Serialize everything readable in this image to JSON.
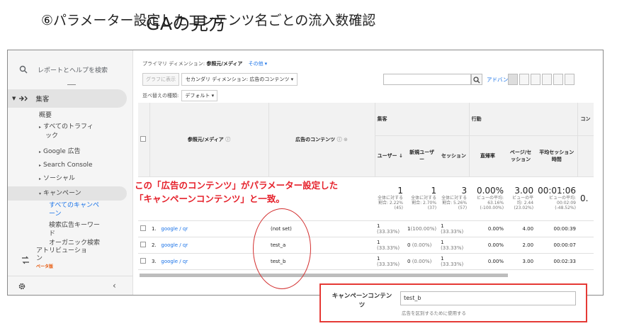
{
  "slide": {
    "title": "GAの見方",
    "subtitle": "⑥パラメーター設定したコンテンツ名ごとの流入数確認"
  },
  "sidebar": {
    "search_placeholder": "レポートとヘルプを検索",
    "acquisition": "集客",
    "items": {
      "overview": "概要",
      "all_traffic_1": "すべてのトラフィ",
      "all_traffic_2": "ック",
      "google_ads": "Google 広告",
      "search_console": "Search Console",
      "social": "ソーシャル",
      "campaigns": "キャンペーン",
      "all_campaigns_1": "すべてのキャンペ",
      "all_campaigns_2": "ーン",
      "paid_keywords_1": "検索広告キーワー",
      "paid_keywords_2": "ド",
      "organic_keywords": "オーガニック検索"
    },
    "attribution_1": "アトリビューショ",
    "attribution_2": "ン",
    "beta": "ベータ版"
  },
  "report": {
    "primary_dim_label": "プライマリ ディメンション:",
    "primary_dim_value": "参照元/メディア",
    "other_label": "その他",
    "graph_btn": "グラフに表示",
    "secondary_dim_btn": "セカンダリ ディメンション: 広告のコンテンツ",
    "sort_label": "並べ替えの種類:",
    "sort_value": "デフォルト",
    "advanced": "アドバンス",
    "group_acq": "集客",
    "group_beh": "行動",
    "group_conv": "コン",
    "col_source": "参照元/メディア",
    "col_content": "広告のコンテンツ",
    "col_users": "ユーザー",
    "col_new_users": "新規ユーザー",
    "col_sessions": "セッション",
    "col_bounce": "直帰率",
    "col_pages": "ページ/セッション",
    "col_duration": "平均セッション時間",
    "totals": {
      "users": "1",
      "users_sub": "全体に対する割合: 2.22% (45)",
      "new_users": "1",
      "new_users_sub": "全体に対する割合: 2.70% (37)",
      "sessions": "3",
      "sessions_sub": "全体に対する割合: 5.26% (57)",
      "bounce": "0.00%",
      "bounce_sub": "ビューの平均: 63.16% (-100.00%)",
      "pages": "3.00",
      "pages_sub": "ビューの平均: 2.44 (23.02%)",
      "duration": "00:01:06",
      "duration_sub": "ビューの平均: 00:02:09 (-48.52%)",
      "conv": "0."
    },
    "rows": [
      {
        "idx": "1.",
        "source": "google / qr",
        "content": "(not set)",
        "users": "1",
        "users_pct": "(33.33%)",
        "new_users": "1",
        "new_users_pct": "(100.00%)",
        "sessions": "1",
        "sessions_pct": "(33.33%)",
        "bounce": "0.00%",
        "pages": "4.00",
        "duration": "00:00:39"
      },
      {
        "idx": "2.",
        "source": "google / qr",
        "content": "test_a",
        "users": "1",
        "users_pct": "(33.33%)",
        "new_users": "0",
        "new_users_pct": "(0.00%)",
        "sessions": "1",
        "sessions_pct": "(33.33%)",
        "bounce": "0.00%",
        "pages": "2.00",
        "duration": "00:00:07"
      },
      {
        "idx": "3.",
        "source": "google / qr",
        "content": "test_b",
        "users": "1",
        "users_pct": "(33.33%)",
        "new_users": "0",
        "new_users_pct": "(0.00%)",
        "sessions": "1",
        "sessions_pct": "(33.33%)",
        "bounce": "0.00%",
        "pages": "3.00",
        "duration": "00:02:33"
      }
    ]
  },
  "annotation": {
    "line1": "この「広告のコンテンツ」がパラメーター設定した",
    "line2": "「キャンペーンコンテンツ」と一致。",
    "color": "#e5202a"
  },
  "popup": {
    "label_1": "キャンペーンコンテン",
    "label_2": "ツ",
    "value": "test_b",
    "help": "広告を区別するために使用する",
    "border_color": "#e53935"
  },
  "colors": {
    "link": "#1a73e8",
    "beta": "#e65100"
  }
}
